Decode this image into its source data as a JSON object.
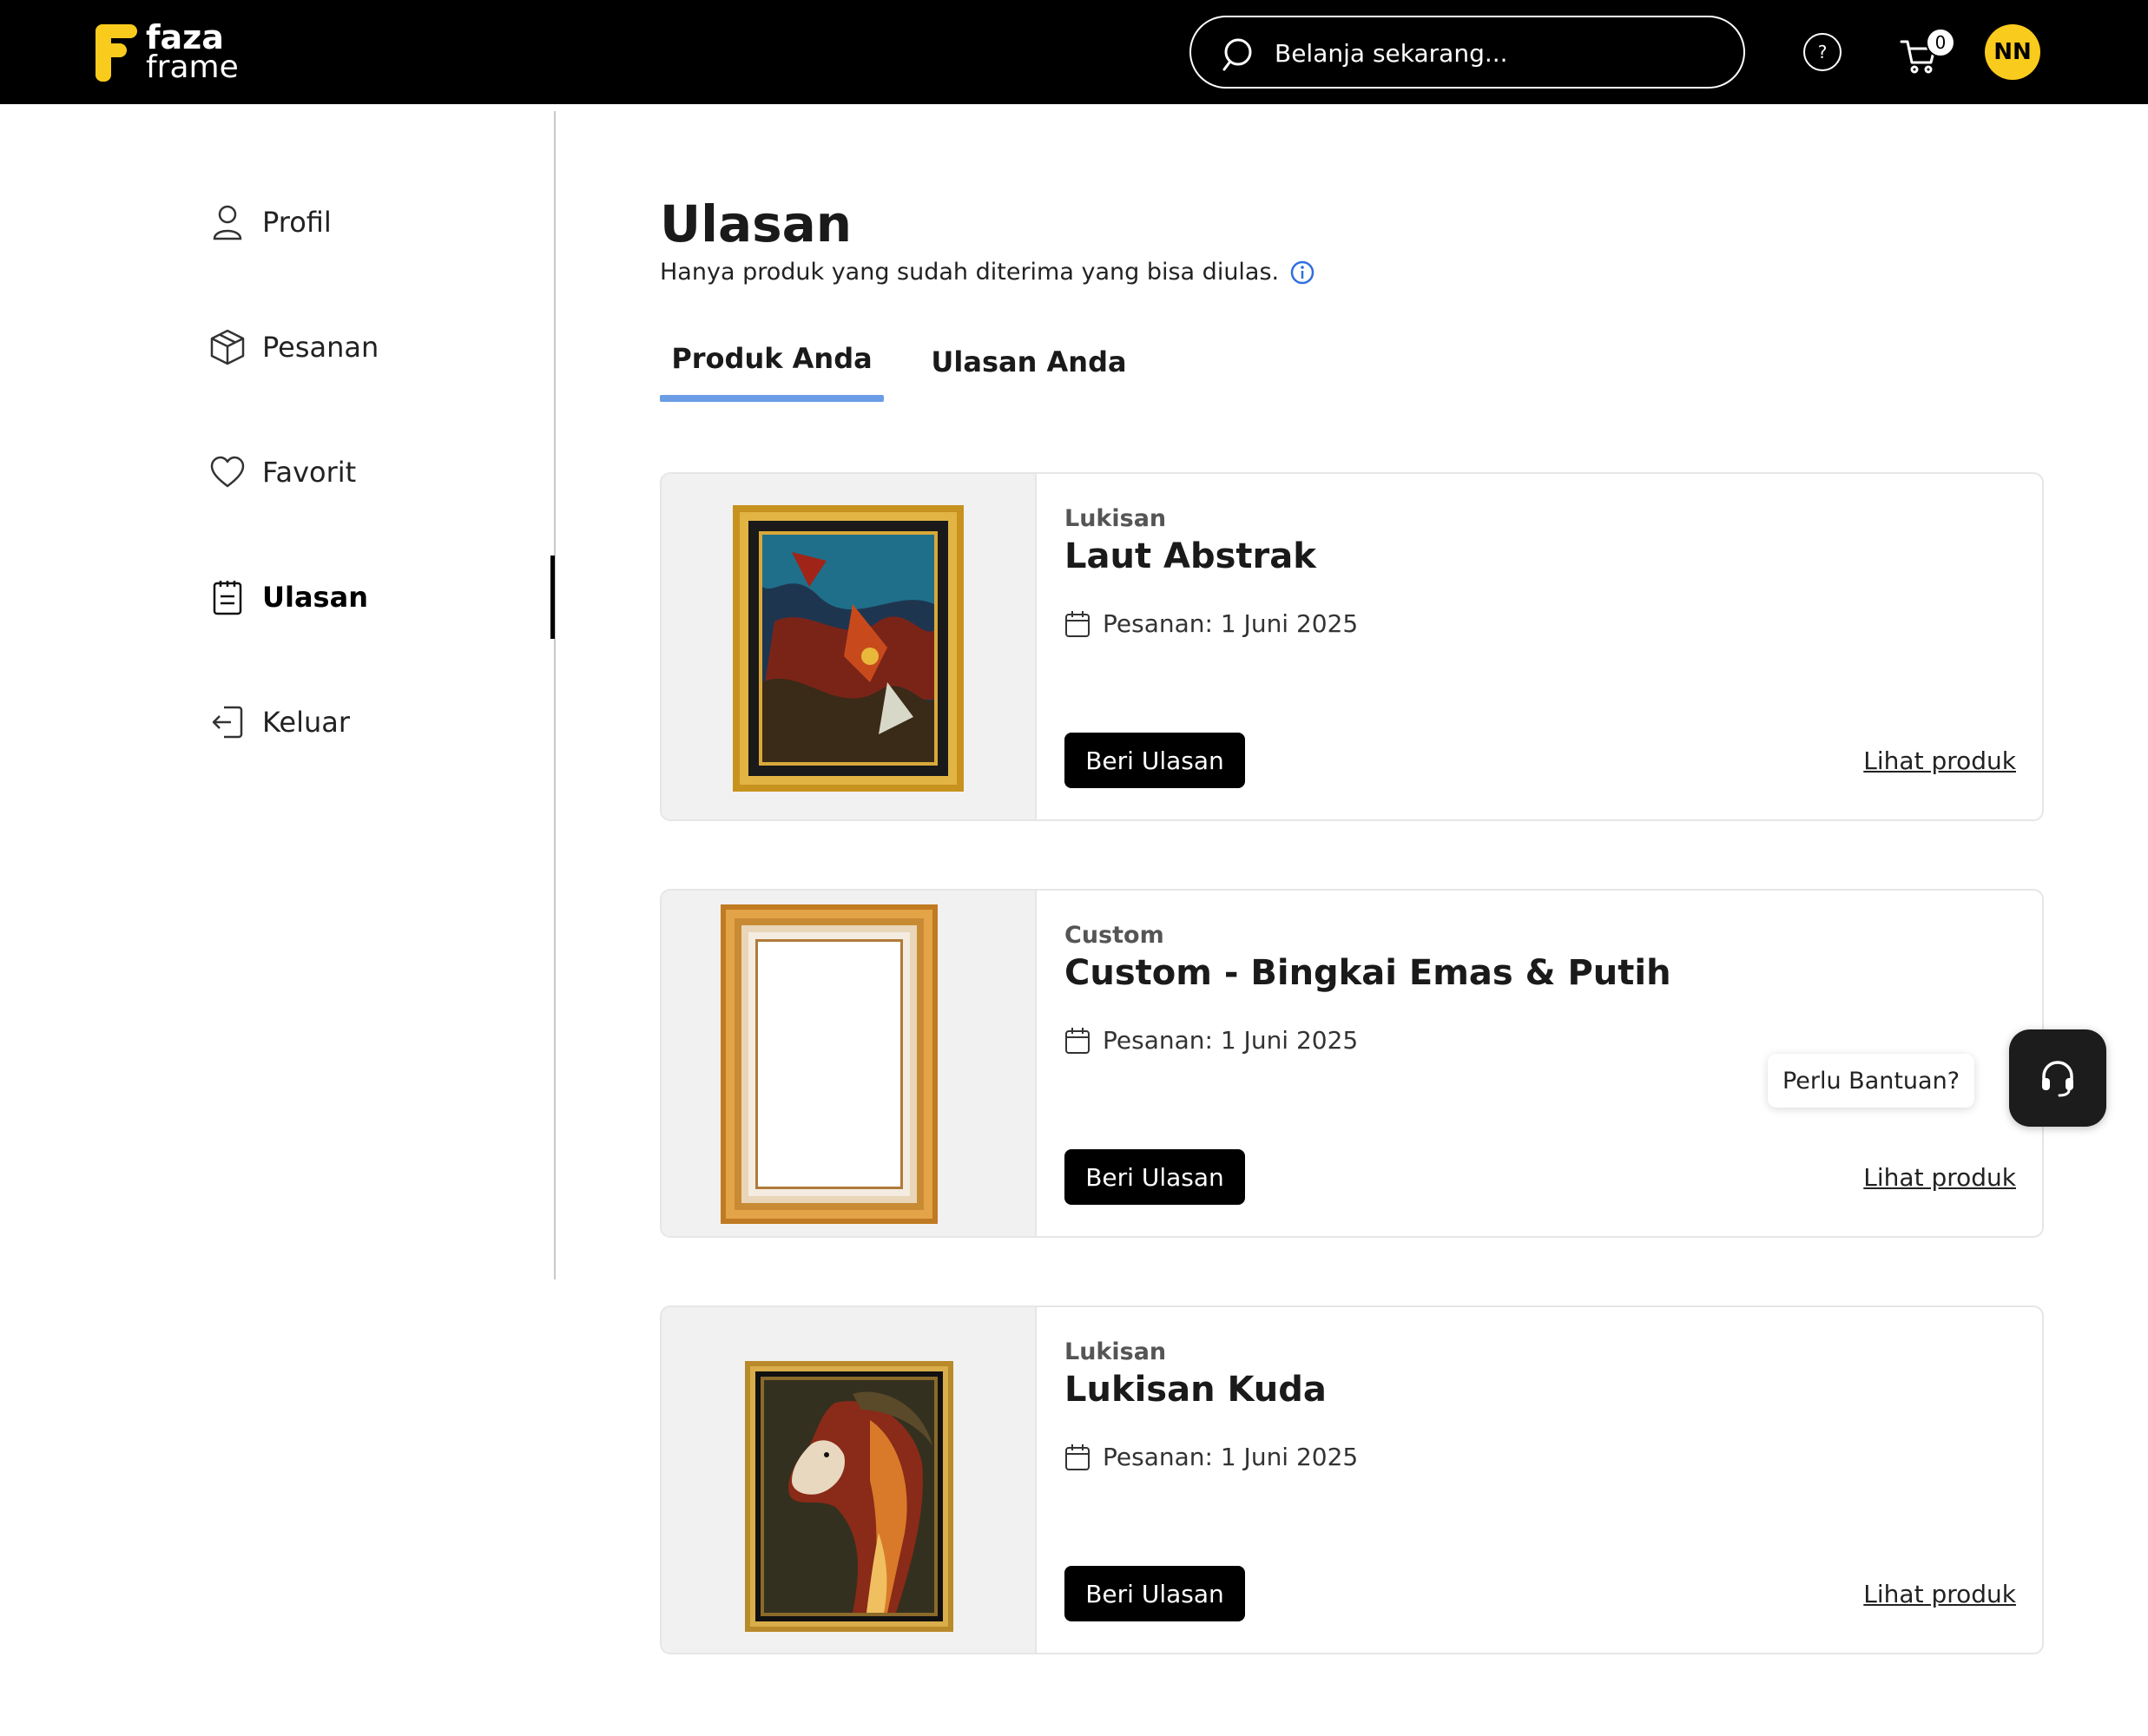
{
  "header": {
    "logo_line1": "faza",
    "logo_line2": "frame",
    "search_placeholder": "Belanja sekarang...",
    "help_icon_label": "?",
    "cart_count": "0",
    "avatar_initials": "NN",
    "brand_color": "#f9cb1d"
  },
  "sidebar": {
    "items": [
      {
        "label": "Profil",
        "icon": "user-icon"
      },
      {
        "label": "Pesanan",
        "icon": "package-icon"
      },
      {
        "label": "Favorit",
        "icon": "heart-icon"
      },
      {
        "label": "Ulasan",
        "icon": "clipboard-icon",
        "active": true
      },
      {
        "label": "Keluar",
        "icon": "logout-icon"
      }
    ]
  },
  "main": {
    "title": "Ulasan",
    "subtitle": "Hanya produk yang sudah diterima yang bisa diulas.",
    "tabs": [
      {
        "label": "Produk Anda",
        "active": true
      },
      {
        "label": "Ulasan Anda"
      }
    ],
    "tab_accent_color": "#6b9de6",
    "products": [
      {
        "category": "Lukisan",
        "name": "Laut Abstrak",
        "order_date": "Pesanan: 1 Juni 2025",
        "button": "Beri Ulasan",
        "link": "Lihat produk"
      },
      {
        "category": "Custom",
        "name": "Custom - Bingkai Emas & Putih",
        "order_date": "Pesanan: 1 Juni 2025",
        "button": "Beri Ulasan",
        "link": "Lihat produk"
      },
      {
        "category": "Lukisan",
        "name": "Lukisan Kuda",
        "order_date": "Pesanan: 1 Juni 2025",
        "button": "Beri Ulasan",
        "link": "Lihat produk"
      }
    ]
  },
  "support": {
    "bubble_text": "Perlu Bantuan?"
  }
}
